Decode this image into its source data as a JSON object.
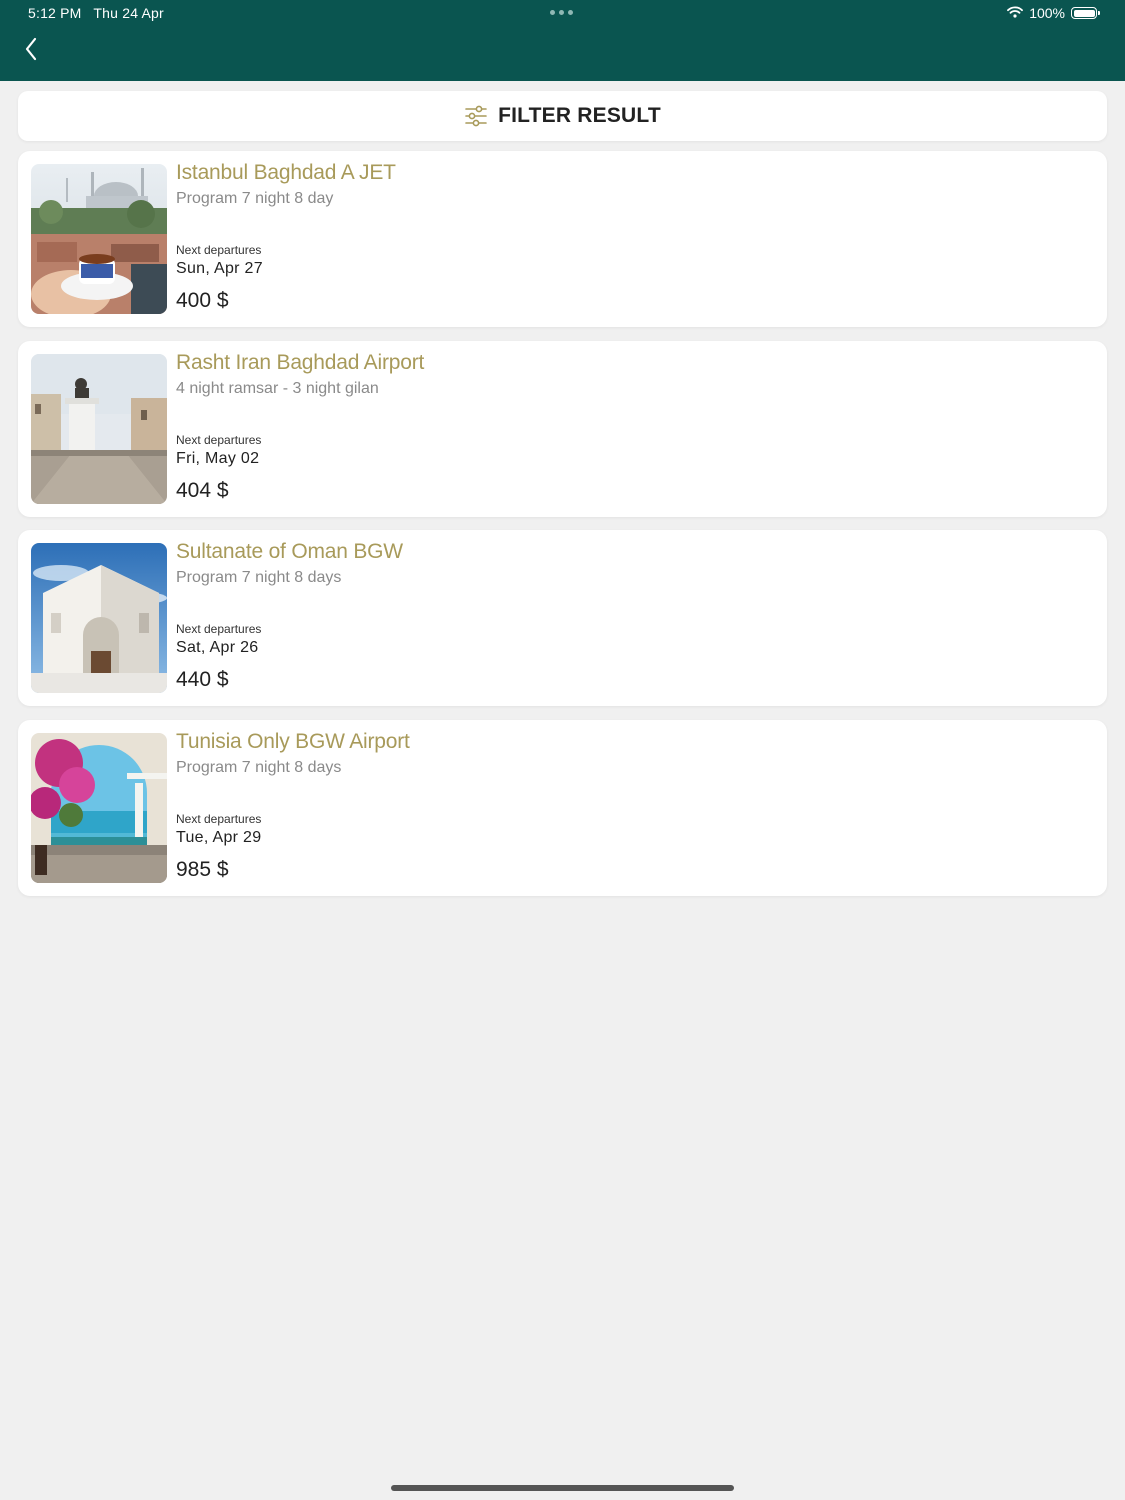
{
  "status_bar": {
    "time": "5:12 PM",
    "date": "Thu 24 Apr",
    "battery": "100%"
  },
  "icons": {
    "back": "chevron-left-icon",
    "filter": "sliders-icon",
    "wifi": "wifi-icon",
    "battery": "battery-icon"
  },
  "colors": {
    "header": "#0a5550",
    "accent_title": "#a89a5a",
    "background": "#f0f0f0"
  },
  "filter": {
    "label": "FILTER RESULT"
  },
  "trips": [
    {
      "title": "Istanbul Baghdad A JET",
      "subtitle": "Program 7 night 8 day",
      "next_label": "Next departures",
      "date": "Sun, Apr 27",
      "price": "400 $"
    },
    {
      "title": "Rasht Iran Baghdad Airport",
      "subtitle": "4 night ramsar - 3 night gilan",
      "next_label": "Next departures",
      "date": "Fri, May 02",
      "price": "404 $"
    },
    {
      "title": "Sultanate of Oman BGW",
      "subtitle": "Program 7 night 8 days",
      "next_label": "Next departures",
      "date": "Sat, Apr 26",
      "price": "440 $"
    },
    {
      "title": "Tunisia Only BGW Airport",
      "subtitle": "Program 7 night 8 days",
      "next_label": "Next departures",
      "date": "Tue, Apr 29",
      "price": "985 $"
    }
  ]
}
